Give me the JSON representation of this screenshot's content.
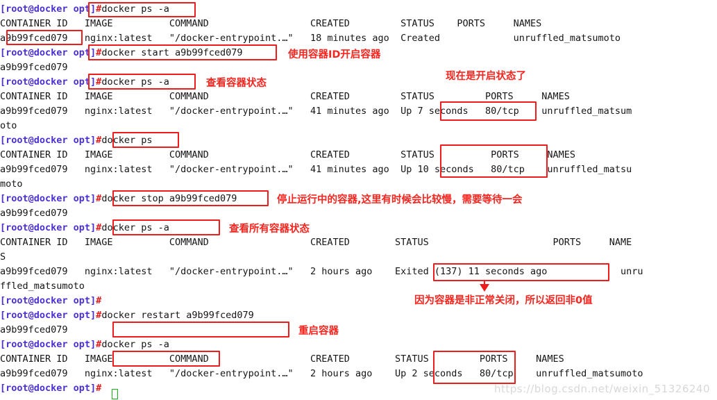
{
  "terminal": {
    "prompt": "[root@docker opt]#",
    "container_id": "a9b99fced079",
    "image": "nginx:latest",
    "command": "\"/docker-entrypoint.…\"",
    "headers": {
      "container_id": "CONTAINER ID",
      "image": "IMAGE",
      "command": "COMMAND",
      "created": "CREATED",
      "status": "STATUS",
      "ports": "PORTS",
      "names": "NAMES"
    },
    "lines": [
      {
        "id": "l1",
        "type": "prompt",
        "cmd": "docker ps -a"
      },
      {
        "id": "l2",
        "type": "out",
        "text": "CONTAINER ID   IMAGE          COMMAND                  CREATED         STATUS    PORTS     NAMES"
      },
      {
        "id": "l3",
        "type": "out",
        "text": "a9b99fced079   nginx:latest   \"/docker-entrypoint.…\"   18 minutes ago  Created             unruffled_matsumoto"
      },
      {
        "id": "l4",
        "type": "prompt",
        "cmd": "docker start a9b99fced079"
      },
      {
        "id": "l5",
        "type": "out",
        "text": "a9b99fced079"
      },
      {
        "id": "l6",
        "type": "prompt",
        "cmd": "docker ps -a"
      },
      {
        "id": "l7",
        "type": "out",
        "text": "CONTAINER ID   IMAGE          COMMAND                  CREATED         STATUS         PORTS     NAMES"
      },
      {
        "id": "l8",
        "type": "out",
        "text": "a9b99fced079   nginx:latest   \"/docker-entrypoint.…\"   41 minutes ago  Up 7 seconds   80/tcp    unruffled_matsum"
      },
      {
        "id": "l9",
        "type": "out",
        "text": "oto"
      },
      {
        "id": "l10",
        "type": "prompt",
        "cmd": "docker ps"
      },
      {
        "id": "l11",
        "type": "out",
        "text": "CONTAINER ID   IMAGE          COMMAND                  CREATED         STATUS          PORTS     NAMES"
      },
      {
        "id": "l12",
        "type": "out",
        "text": "a9b99fced079   nginx:latest   \"/docker-entrypoint.…\"   41 minutes ago  Up 10 seconds   80/tcp    unruffled_matsu"
      },
      {
        "id": "l13",
        "type": "out",
        "text": "moto"
      },
      {
        "id": "l14",
        "type": "prompt",
        "cmd": "docker stop a9b99fced079"
      },
      {
        "id": "l15",
        "type": "out",
        "text": "a9b99fced079"
      },
      {
        "id": "l16",
        "type": "prompt",
        "cmd": "docker ps -a"
      },
      {
        "id": "l17",
        "type": "out",
        "text": "CONTAINER ID   IMAGE          COMMAND                  CREATED        STATUS                      PORTS     NAME"
      },
      {
        "id": "l18",
        "type": "out",
        "text": "S"
      },
      {
        "id": "l19",
        "type": "out",
        "text": "a9b99fced079   nginx:latest   \"/docker-entrypoint.…\"   2 hours ago    Exited (137) 11 seconds ago             unru"
      },
      {
        "id": "l20",
        "type": "out",
        "text": "ffled_matsumoto"
      },
      {
        "id": "l21",
        "type": "prompt",
        "cmd": ""
      },
      {
        "id": "l22",
        "type": "prompt",
        "cmd": "docker restart a9b99fced079"
      },
      {
        "id": "l23",
        "type": "out",
        "text": "a9b99fced079"
      },
      {
        "id": "l24",
        "type": "prompt",
        "cmd": "docker ps -a"
      },
      {
        "id": "l25",
        "type": "out",
        "text": "CONTAINER ID   IMAGE          COMMAND                  CREATED        STATUS         PORTS     NAMES"
      },
      {
        "id": "l26",
        "type": "out",
        "text": "a9b99fced079   nginx:latest   \"/docker-entrypoint.…\"   2 hours ago    Up 2 seconds   80/tcp    unruffled_matsumoto"
      },
      {
        "id": "l27",
        "type": "prompt",
        "cmd": ""
      }
    ]
  },
  "annotations": {
    "color": "#f5251f",
    "notes": [
      {
        "id": "n1",
        "text": "使用容器ID开启容器"
      },
      {
        "id": "n2",
        "text": "查看容器状态"
      },
      {
        "id": "n3",
        "text": "现在是开启状态了"
      },
      {
        "id": "n4",
        "text": "停止运行中的容器,这里有时候会比较慢，需要等待一会"
      },
      {
        "id": "n5",
        "text": "查看所有容器状态"
      },
      {
        "id": "n6",
        "text": "因为容器是非正常关闭，所以返回非0值"
      },
      {
        "id": "n7",
        "text": "重启容器"
      }
    ]
  },
  "watermark": {
    "text": "https://blog.csdn.net/weixin_51326240"
  }
}
